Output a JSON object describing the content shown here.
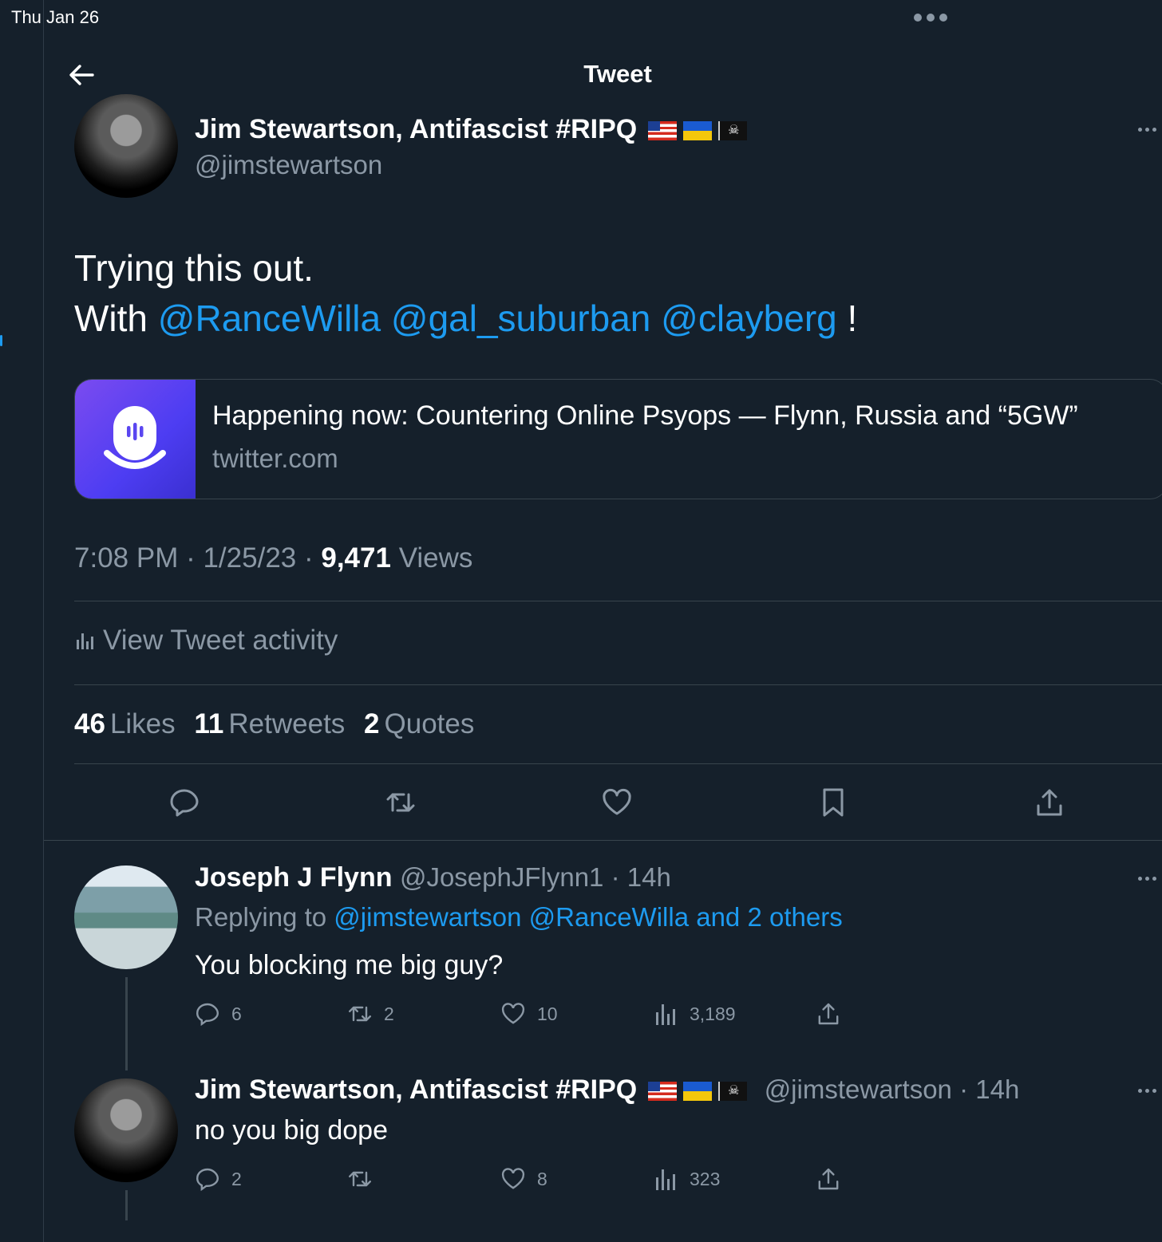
{
  "status_bar": {
    "date": "Thu Jan 26"
  },
  "header": {
    "title": "Tweet"
  },
  "tweet": {
    "author_name": "Jim Stewartson, Antifascist #RIPQ",
    "author_handle": "@jimstewartson",
    "text_line1": "Trying this out.",
    "text_with": "With",
    "mentions": [
      "@RanceWilla",
      "@gal_suburban",
      "@clayberg"
    ],
    "text_end": "!",
    "card": {
      "title": "Happening now: Countering Online Psyops — Flynn, Russia and “5GW”",
      "domain": "twitter.com"
    },
    "time": "7:08 PM",
    "date": "1/25/23",
    "views_count": "9,471",
    "views_label": "Views",
    "activity_label": "View Tweet activity",
    "likes_count": "46",
    "likes_label": "Likes",
    "retweets_count": "11",
    "retweets_label": "Retweets",
    "quotes_count": "2",
    "quotes_label": "Quotes"
  },
  "replies": [
    {
      "name": "Joseph J Flynn",
      "handle": "@JosephJFlynn1",
      "time": "14h",
      "replying_prefix": "Replying to",
      "replying_targets": "@jimstewartson @RanceWilla and 2 others",
      "text": "You blocking me big guy?",
      "reply_count": "6",
      "retweet_count": "2",
      "like_count": "10",
      "view_count": "3,189"
    },
    {
      "name": "Jim Stewartson, Antifascist #RIPQ",
      "handle": "@jimstewartson",
      "time": "14h",
      "text": "no you big dope",
      "reply_count": "2",
      "retweet_count": "",
      "like_count": "8",
      "view_count": "323"
    }
  ],
  "colors": {
    "background": "#15202b",
    "accent": "#1d9bf0",
    "muted": "#8b98a5",
    "border": "#38444d"
  }
}
